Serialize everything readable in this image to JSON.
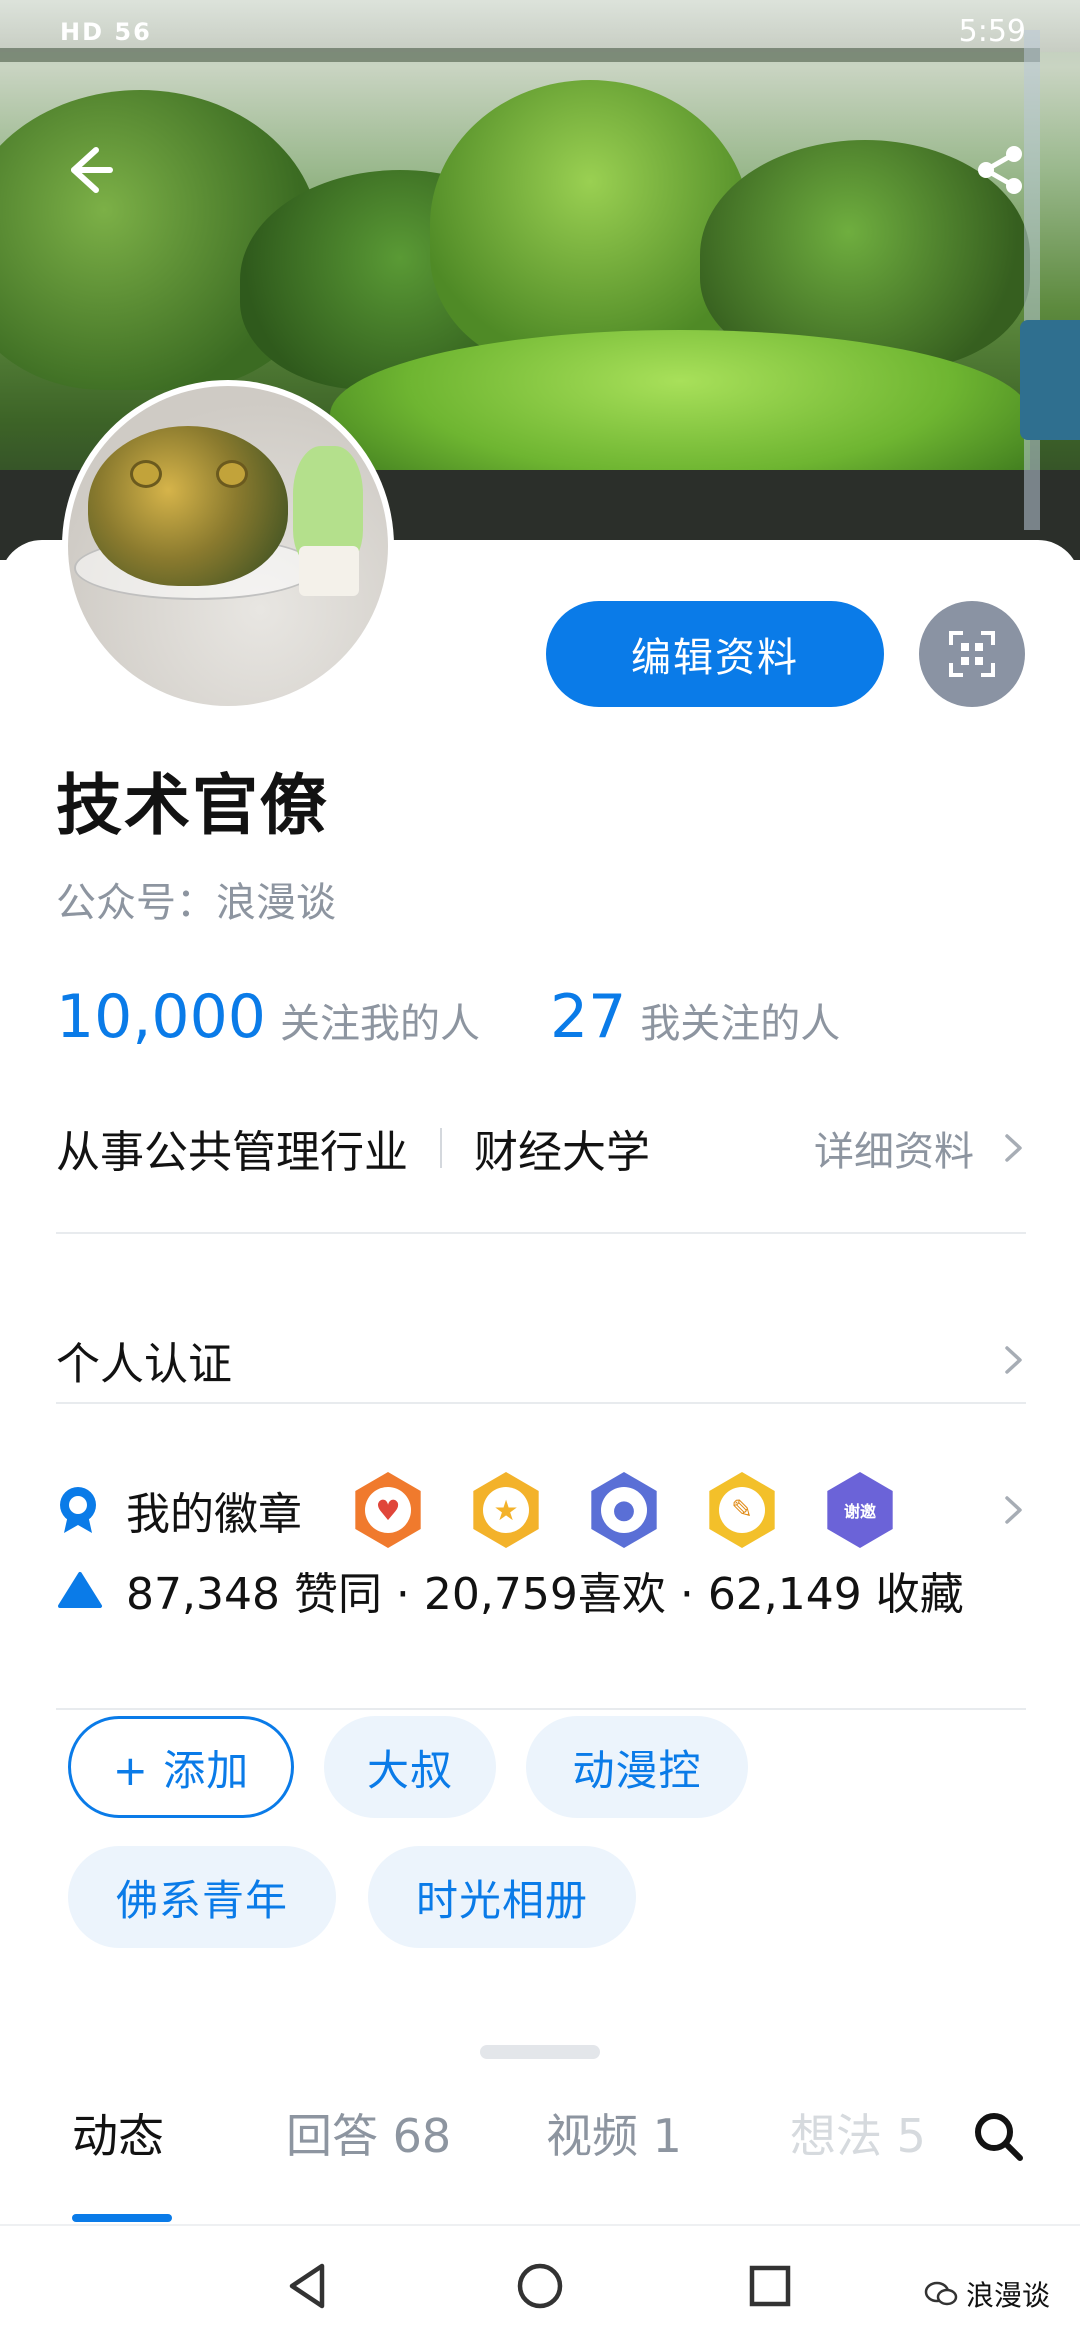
{
  "status_bar": {
    "left": "HD 56",
    "time": "5:59"
  },
  "profile": {
    "name": "技术官僚",
    "org_prefix": "公众号：",
    "org_name": "浪漫谈",
    "edit_button": "编辑资料",
    "followers_count": "10,000",
    "followers_label": "关注我的人",
    "following_count": "27",
    "following_label": "我关注的人",
    "industry": "从事公共管理行业",
    "school": "财经大学",
    "detail_link": "详细资料",
    "personal_auth": "个人认证",
    "badges_label": "我的徽章",
    "badges": [
      {
        "icon": "badge-heart-icon",
        "color": "#f07a2d"
      },
      {
        "icon": "badge-star-icon",
        "color": "#f3b22a"
      },
      {
        "icon": "badge-bear-icon",
        "color": "#5a6fd6"
      },
      {
        "icon": "badge-pen-icon",
        "color": "#f3c02a"
      },
      {
        "icon": "badge-thanks-icon",
        "color": "#6b63d8",
        "text": "谢邀"
      }
    ],
    "stats_text": "87,348 赞同 · 20,759喜欢 · 62,149 收藏"
  },
  "tags": {
    "add": "+ 添加",
    "items": [
      "大叔",
      "动漫控",
      "佛系青年",
      "时光相册"
    ]
  },
  "tabs": [
    {
      "label": "动态",
      "active": true
    },
    {
      "label": "回答 68",
      "active": false
    },
    {
      "label": "视频 1",
      "active": false
    },
    {
      "label": "想法 5",
      "active": false
    }
  ],
  "watermark": "浪漫谈",
  "colors": {
    "accent": "#0a7be8",
    "muted": "#8d95a0",
    "tag_bg": "#ecf4fc"
  }
}
